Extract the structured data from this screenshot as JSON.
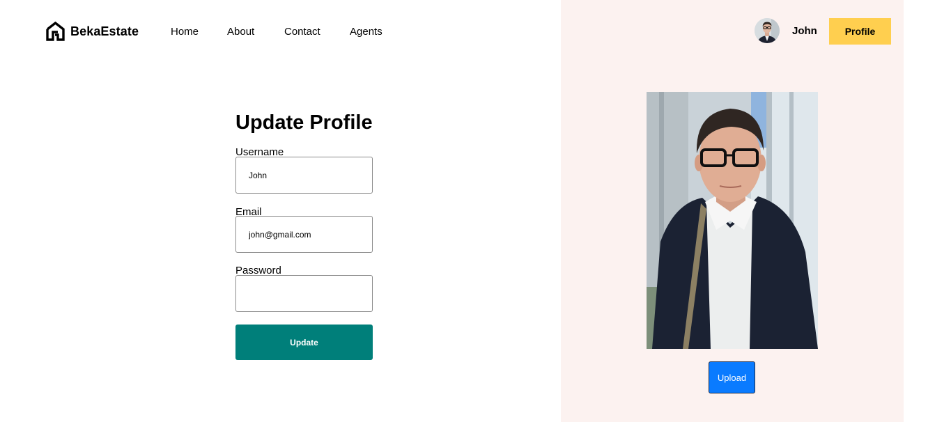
{
  "brand": {
    "name": "BekaEstate",
    "icon": "house-logo-icon"
  },
  "nav": {
    "items": [
      "Home",
      "About",
      "Contact",
      "Agents"
    ]
  },
  "user": {
    "name": "John",
    "profile_button": "Profile"
  },
  "form": {
    "title": "Update Profile",
    "username": {
      "label": "Username",
      "value": "John"
    },
    "email": {
      "label": "Email",
      "value": "john@gmail.com"
    },
    "password": {
      "label": "Password",
      "value": ""
    },
    "submit_label": "Update"
  },
  "photo": {
    "upload_label": "Upload"
  },
  "colors": {
    "accent_yellow": "#ffcf4f",
    "update_teal": "#007f7a",
    "upload_blue": "#0a7bff",
    "panel_bg": "#fcf2f0"
  }
}
